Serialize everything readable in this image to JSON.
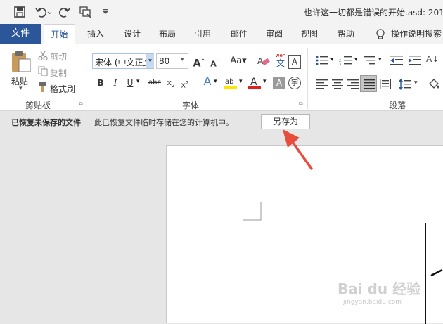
{
  "titlebar": {
    "title": "也许这一切都是错误的开始.asd: 201"
  },
  "tabs": {
    "file": "文件",
    "home": "开始",
    "insert": "插入",
    "design": "设计",
    "layout": "布局",
    "references": "引用",
    "mailings": "邮件",
    "review": "审阅",
    "view": "视图",
    "help": "帮助",
    "tell_me": "操作说明搜索"
  },
  "clipboard": {
    "paste": "粘贴",
    "cut": "剪切",
    "copy": "复制",
    "format_painter": "格式刷",
    "group_label": "剪贴板"
  },
  "font": {
    "name": "宋体 (中文正文",
    "size": "80",
    "group_label": "字体",
    "pinyin_top": "wén",
    "pinyin_char": "文"
  },
  "paragraph": {
    "group_label": "段落"
  },
  "message_bar": {
    "title": "已恢复未保存的文件",
    "description": "此已恢复文件临时存储在您的计算机中。",
    "save_as": "另存为"
  },
  "watermark": {
    "logo": "Bai du 经验",
    "url": "jingyan.baidu.com"
  },
  "colors": {
    "accent": "#2b579a",
    "arrow": "#e84c3d"
  }
}
